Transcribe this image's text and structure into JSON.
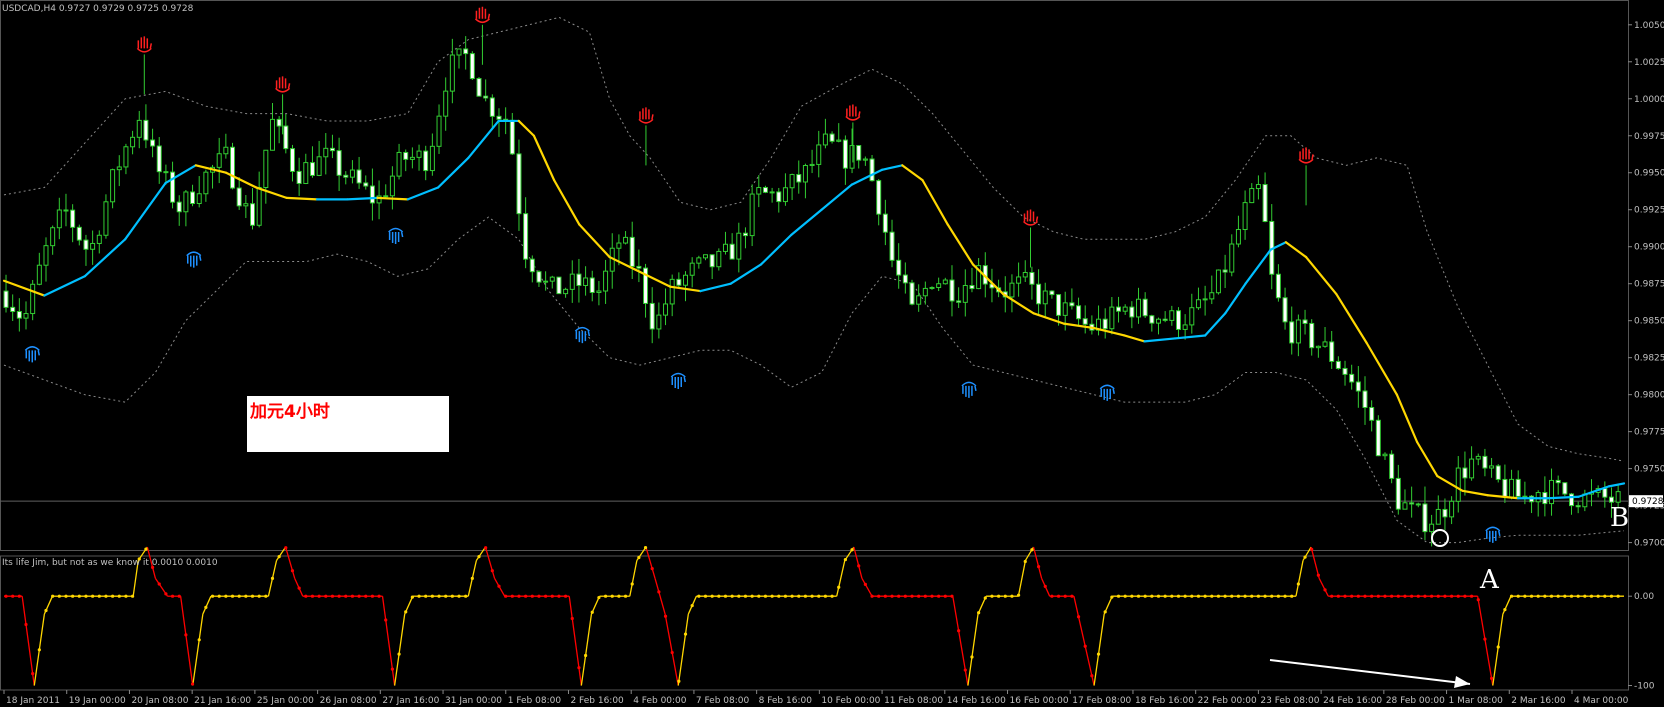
{
  "chart_data": {
    "type": "candlestick",
    "symbol_header": "USDCAD,H4  0.9727 0.9729 0.9725 0.9728",
    "price_axis": {
      "ticks": [
        "1.0050",
        "1.0025",
        "1.0000",
        "0.9975",
        "0.9950",
        "0.9925",
        "0.9900",
        "0.9875",
        "0.9850",
        "0.9825",
        "0.9800",
        "0.9775",
        "0.9750",
        "0.9725",
        "0.9700"
      ],
      "ylim": [
        0.9695,
        1.006
      ],
      "current_price": "0.9728",
      "current_price_value": 0.9728
    },
    "time_axis": {
      "ticks": [
        "18 Jan 2011",
        "19 Jan 00:00",
        "20 Jan 08:00",
        "21 Jan 16:00",
        "25 Jan 00:00",
        "26 Jan 08:00",
        "27 Jan 16:00",
        "31 Jan 00:00",
        "1 Feb 08:00",
        "2 Feb 16:00",
        "4 Feb 00:00",
        "7 Feb 08:00",
        "8 Feb 16:00",
        "10 Feb 00:00",
        "11 Feb 08:00",
        "14 Feb 16:00",
        "16 Feb 00:00",
        "17 Feb 08:00",
        "18 Feb 16:00",
        "22 Feb 00:00",
        "23 Feb 08:00",
        "24 Feb 16:00",
        "28 Feb 00:00",
        "1 Mar 08:00",
        "2 Mar 16:00",
        "4 Mar 00:00"
      ]
    },
    "price_path": [
      [
        0,
        0.987
      ],
      [
        20,
        0.985
      ],
      [
        40,
        0.9895
      ],
      [
        60,
        0.9925
      ],
      [
        85,
        0.9895
      ],
      [
        110,
        0.995
      ],
      [
        135,
        0.999
      ],
      [
        150,
        0.9955
      ],
      [
        175,
        0.9925
      ],
      [
        195,
        0.9945
      ],
      [
        220,
        0.996
      ],
      [
        245,
        0.9915
      ],
      [
        265,
        0.9985
      ],
      [
        290,
        0.995
      ],
      [
        320,
        0.996
      ],
      [
        345,
        0.9945
      ],
      [
        370,
        0.993
      ],
      [
        395,
        0.996
      ],
      [
        420,
        0.996
      ],
      [
        440,
        1.002
      ],
      [
        460,
        1.003
      ],
      [
        475,
        1.0
      ],
      [
        500,
        0.9985
      ],
      [
        515,
        0.99
      ],
      [
        540,
        0.987
      ],
      [
        570,
        0.9875
      ],
      [
        590,
        0.987
      ],
      [
        610,
        0.9905
      ],
      [
        630,
        0.988
      ],
      [
        645,
        0.9845
      ],
      [
        660,
        0.987
      ],
      [
        685,
        0.9885
      ],
      [
        710,
        0.989
      ],
      [
        730,
        0.9905
      ],
      [
        745,
        0.9935
      ],
      [
        770,
        0.9935
      ],
      [
        795,
        0.995
      ],
      [
        815,
        0.997
      ],
      [
        835,
        0.996
      ],
      [
        850,
        0.9965
      ],
      [
        865,
        0.9935
      ],
      [
        880,
        0.989
      ],
      [
        900,
        0.9855
      ],
      [
        920,
        0.988
      ],
      [
        945,
        0.987
      ],
      [
        965,
        0.9885
      ],
      [
        990,
        0.987
      ],
      [
        1010,
        0.9875
      ],
      [
        1030,
        0.9865
      ],
      [
        1055,
        0.9855
      ],
      [
        1075,
        0.9845
      ],
      [
        1095,
        0.985
      ],
      [
        1115,
        0.986
      ],
      [
        1135,
        0.9855
      ],
      [
        1160,
        0.985
      ],
      [
        1180,
        0.9855
      ],
      [
        1200,
        0.987
      ],
      [
        1215,
        0.9895
      ],
      [
        1230,
        0.9925
      ],
      [
        1245,
        0.994
      ],
      [
        1255,
        0.988
      ],
      [
        1270,
        0.9845
      ],
      [
        1290,
        0.984
      ],
      [
        1310,
        0.983
      ],
      [
        1330,
        0.9815
      ],
      [
        1350,
        0.979
      ],
      [
        1365,
        0.976
      ],
      [
        1380,
        0.973
      ],
      [
        1395,
        0.972
      ],
      [
        1410,
        0.9715
      ],
      [
        1425,
        0.972
      ],
      [
        1440,
        0.9745
      ],
      [
        1455,
        0.9755
      ],
      [
        1470,
        0.9745
      ],
      [
        1490,
        0.9735
      ],
      [
        1505,
        0.973
      ],
      [
        1520,
        0.9735
      ],
      [
        1535,
        0.9735
      ],
      [
        1550,
        0.9733
      ],
      [
        1565,
        0.973
      ],
      [
        1585,
        0.973
      ],
      [
        1600,
        0.9728
      ]
    ],
    "moving_average": [
      [
        0,
        0.9877
      ],
      [
        40,
        0.9867
      ],
      [
        80,
        0.988
      ],
      [
        120,
        0.9905
      ],
      [
        160,
        0.9943
      ],
      [
        190,
        0.9955
      ],
      [
        220,
        0.995
      ],
      [
        250,
        0.994
      ],
      [
        280,
        0.9933
      ],
      [
        310,
        0.9932
      ],
      [
        340,
        0.9932
      ],
      [
        370,
        0.9933
      ],
      [
        400,
        0.9932
      ],
      [
        430,
        0.994
      ],
      [
        460,
        0.996
      ],
      [
        490,
        0.9985
      ],
      [
        510,
        0.9985
      ],
      [
        525,
        0.9975
      ],
      [
        545,
        0.9945
      ],
      [
        570,
        0.9915
      ],
      [
        600,
        0.9893
      ],
      [
        630,
        0.9883
      ],
      [
        660,
        0.9873
      ],
      [
        690,
        0.987
      ],
      [
        720,
        0.9875
      ],
      [
        750,
        0.9888
      ],
      [
        780,
        0.9908
      ],
      [
        810,
        0.9925
      ],
      [
        840,
        0.9942
      ],
      [
        870,
        0.9952
      ],
      [
        890,
        0.9955
      ],
      [
        910,
        0.9945
      ],
      [
        935,
        0.9915
      ],
      [
        960,
        0.9888
      ],
      [
        990,
        0.9868
      ],
      [
        1020,
        0.9855
      ],
      [
        1050,
        0.9848
      ],
      [
        1080,
        0.9845
      ],
      [
        1110,
        0.984
      ],
      [
        1130,
        0.9836
      ],
      [
        1160,
        0.9838
      ],
      [
        1190,
        0.984
      ],
      [
        1210,
        0.9855
      ],
      [
        1230,
        0.9875
      ],
      [
        1255,
        0.9898
      ],
      [
        1270,
        0.9903
      ],
      [
        1290,
        0.9893
      ],
      [
        1320,
        0.9868
      ],
      [
        1350,
        0.9835
      ],
      [
        1380,
        0.98
      ],
      [
        1400,
        0.9768
      ],
      [
        1420,
        0.9745
      ],
      [
        1445,
        0.9735
      ],
      [
        1470,
        0.9732
      ],
      [
        1500,
        0.973
      ],
      [
        1530,
        0.973
      ],
      [
        1560,
        0.9731
      ],
      [
        1590,
        0.9738
      ],
      [
        1605,
        0.974
      ]
    ],
    "ma_colors": {
      "rising": "#00bfff",
      "falling": "#ffd700"
    },
    "bollinger_upper": [
      [
        0,
        0.9935
      ],
      [
        40,
        0.994
      ],
      [
        80,
        0.997
      ],
      [
        120,
        1.0
      ],
      [
        160,
        1.0005
      ],
      [
        200,
        0.9995
      ],
      [
        240,
        0.999
      ],
      [
        280,
        0.999
      ],
      [
        320,
        0.9985
      ],
      [
        360,
        0.9985
      ],
      [
        400,
        0.999
      ],
      [
        430,
        1.0025
      ],
      [
        460,
        1.004
      ],
      [
        490,
        1.0045
      ],
      [
        520,
        1.005
      ],
      [
        550,
        1.0055
      ],
      [
        580,
        1.0045
      ],
      [
        600,
        1.0
      ],
      [
        620,
        0.9975
      ],
      [
        640,
        0.996
      ],
      [
        670,
        0.993
      ],
      [
        700,
        0.9925
      ],
      [
        730,
        0.993
      ],
      [
        760,
        0.996
      ],
      [
        790,
        0.9995
      ],
      [
        830,
        1.001
      ],
      [
        860,
        1.002
      ],
      [
        890,
        1.001
      ],
      [
        920,
        0.999
      ],
      [
        950,
        0.9965
      ],
      [
        980,
        0.994
      ],
      [
        1010,
        0.992
      ],
      [
        1040,
        0.991
      ],
      [
        1070,
        0.9905
      ],
      [
        1100,
        0.9905
      ],
      [
        1130,
        0.9905
      ],
      [
        1160,
        0.991
      ],
      [
        1190,
        0.992
      ],
      [
        1220,
        0.9945
      ],
      [
        1250,
        0.9975
      ],
      [
        1275,
        0.9975
      ],
      [
        1300,
        0.996
      ],
      [
        1330,
        0.9955
      ],
      [
        1360,
        0.996
      ],
      [
        1390,
        0.9955
      ],
      [
        1410,
        0.991
      ],
      [
        1440,
        0.986
      ],
      [
        1470,
        0.982
      ],
      [
        1500,
        0.978
      ],
      [
        1530,
        0.9765
      ],
      [
        1560,
        0.976
      ],
      [
        1590,
        0.9757
      ],
      [
        1605,
        0.9755
      ]
    ],
    "bollinger_lower": [
      [
        0,
        0.982
      ],
      [
        40,
        0.981
      ],
      [
        80,
        0.98
      ],
      [
        120,
        0.9795
      ],
      [
        150,
        0.9815
      ],
      [
        180,
        0.985
      ],
      [
        210,
        0.987
      ],
      [
        240,
        0.989
      ],
      [
        270,
        0.989
      ],
      [
        300,
        0.989
      ],
      [
        330,
        0.9895
      ],
      [
        360,
        0.989
      ],
      [
        390,
        0.988
      ],
      [
        420,
        0.9885
      ],
      [
        450,
        0.9905
      ],
      [
        480,
        0.992
      ],
      [
        510,
        0.9905
      ],
      [
        540,
        0.987
      ],
      [
        570,
        0.9845
      ],
      [
        600,
        0.9825
      ],
      [
        630,
        0.982
      ],
      [
        660,
        0.9825
      ],
      [
        690,
        0.983
      ],
      [
        720,
        0.983
      ],
      [
        750,
        0.982
      ],
      [
        780,
        0.9805
      ],
      [
        810,
        0.9815
      ],
      [
        840,
        0.9855
      ],
      [
        870,
        0.988
      ],
      [
        900,
        0.9875
      ],
      [
        930,
        0.9845
      ],
      [
        960,
        0.982
      ],
      [
        990,
        0.9815
      ],
      [
        1020,
        0.981
      ],
      [
        1050,
        0.9805
      ],
      [
        1080,
        0.98
      ],
      [
        1110,
        0.9795
      ],
      [
        1140,
        0.9795
      ],
      [
        1170,
        0.9795
      ],
      [
        1200,
        0.98
      ],
      [
        1230,
        0.9815
      ],
      [
        1260,
        0.9815
      ],
      [
        1290,
        0.981
      ],
      [
        1320,
        0.979
      ],
      [
        1350,
        0.9755
      ],
      [
        1380,
        0.9715
      ],
      [
        1410,
        0.97
      ],
      [
        1440,
        0.97
      ],
      [
        1470,
        0.9703
      ],
      [
        1500,
        0.9705
      ],
      [
        1530,
        0.9705
      ],
      [
        1560,
        0.9705
      ],
      [
        1590,
        0.9707
      ],
      [
        1605,
        0.9708
      ]
    ],
    "fractal_up": [
      [
        139,
        1.003
      ],
      [
        276,
        1.0003
      ],
      [
        474,
        1.005
      ],
      [
        636,
        0.9982
      ],
      [
        841,
        0.9984
      ],
      [
        1017,
        0.9913
      ],
      [
        1290,
        0.9955
      ]
    ],
    "fractal_down": [
      [
        28,
        0.9834
      ],
      [
        188,
        0.9898
      ],
      [
        388,
        0.9914
      ],
      [
        573,
        0.9847
      ],
      [
        668,
        0.9816
      ],
      [
        956,
        0.981
      ],
      [
        1093,
        0.9808
      ],
      [
        1475,
        0.9712
      ]
    ],
    "oscillator": {
      "title": "Its life Jim, but not as we know it  0.0010 0.0010",
      "ticks": [
        "0.00",
        "-100"
      ],
      "ylim": [
        -105,
        45
      ],
      "points": [
        [
          0,
          0
        ],
        [
          18,
          0
        ],
        [
          30,
          -100
        ],
        [
          40,
          -20
        ],
        [
          48,
          0
        ],
        [
          60,
          0
        ],
        [
          80,
          0
        ],
        [
          100,
          0
        ],
        [
          120,
          0
        ],
        [
          128,
          0
        ],
        [
          133,
          40
        ],
        [
          142,
          55
        ],
        [
          150,
          20
        ],
        [
          162,
          0
        ],
        [
          175,
          0
        ],
        [
          187,
          -100
        ],
        [
          197,
          -20
        ],
        [
          205,
          0
        ],
        [
          220,
          0
        ],
        [
          240,
          0
        ],
        [
          262,
          0
        ],
        [
          270,
          40
        ],
        [
          279,
          55
        ],
        [
          288,
          20
        ],
        [
          296,
          0
        ],
        [
          320,
          0
        ],
        [
          340,
          0
        ],
        [
          360,
          0
        ],
        [
          375,
          0
        ],
        [
          387,
          -100
        ],
        [
          397,
          -20
        ],
        [
          405,
          0
        ],
        [
          420,
          0
        ],
        [
          440,
          0
        ],
        [
          460,
          0
        ],
        [
          468,
          40
        ],
        [
          477,
          55
        ],
        [
          486,
          20
        ],
        [
          496,
          0
        ],
        [
          520,
          0
        ],
        [
          540,
          0
        ],
        [
          560,
          0
        ],
        [
          572,
          -100
        ],
        [
          582,
          -20
        ],
        [
          590,
          0
        ],
        [
          605,
          0
        ],
        [
          620,
          0
        ],
        [
          627,
          40
        ],
        [
          636,
          55
        ],
        [
          645,
          20
        ],
        [
          655,
          -20
        ],
        [
          668,
          -100
        ],
        [
          678,
          -20
        ],
        [
          686,
          0
        ],
        [
          720,
          0
        ],
        [
          760,
          0
        ],
        [
          800,
          0
        ],
        [
          825,
          0
        ],
        [
          833,
          40
        ],
        [
          842,
          55
        ],
        [
          850,
          20
        ],
        [
          860,
          0
        ],
        [
          900,
          0
        ],
        [
          940,
          0
        ],
        [
          955,
          -100
        ],
        [
          965,
          -20
        ],
        [
          973,
          0
        ],
        [
          990,
          0
        ],
        [
          1005,
          0
        ],
        [
          1012,
          40
        ],
        [
          1020,
          55
        ],
        [
          1028,
          20
        ],
        [
          1036,
          0
        ],
        [
          1060,
          0
        ],
        [
          1080,
          -100
        ],
        [
          1090,
          -20
        ],
        [
          1098,
          0
        ],
        [
          1140,
          0
        ],
        [
          1190,
          0
        ],
        [
          1240,
          0
        ],
        [
          1280,
          0
        ],
        [
          1287,
          40
        ],
        [
          1295,
          55
        ],
        [
          1303,
          20
        ],
        [
          1312,
          0
        ],
        [
          1360,
          0
        ],
        [
          1420,
          0
        ],
        [
          1460,
          0
        ],
        [
          1475,
          -100
        ],
        [
          1485,
          -20
        ],
        [
          1493,
          0
        ],
        [
          1530,
          0
        ],
        [
          1570,
          0
        ],
        [
          1605,
          0
        ]
      ],
      "colors": {
        "up": "#ffd700",
        "down": "#ff0000"
      }
    },
    "annotations": {
      "letter_a": "A",
      "letter_b": "B",
      "circle_mark": "O",
      "label_box": "加元4小时"
    }
  }
}
